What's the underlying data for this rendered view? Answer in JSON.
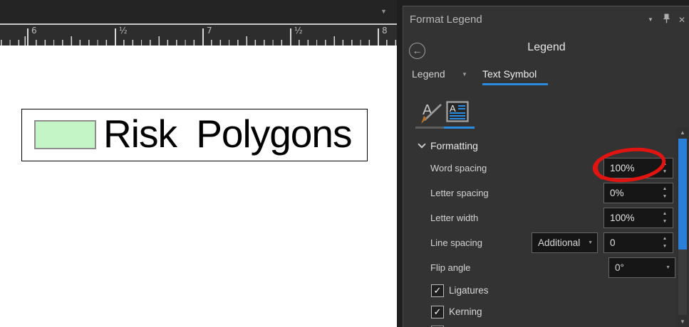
{
  "canvas": {
    "toolbar": {
      "dropdown_icon": "▼"
    },
    "ruler": {
      "labels": [
        "6",
        "½",
        "7",
        "½",
        "8"
      ]
    },
    "legend_item": {
      "label": "Risk Polygons"
    },
    "colors": {
      "swatch_fill": "#c3f5c7",
      "swatch_border": "#8d8d8d"
    }
  },
  "panel": {
    "title": "Format Legend",
    "heading": "Legend",
    "tabs": {
      "primary": "Legend",
      "secondary": "Text Symbol"
    },
    "section": "Formatting",
    "fields": {
      "word_spacing": {
        "label": "Word spacing",
        "value": "100%"
      },
      "letter_spacing": {
        "label": "Letter spacing",
        "value": "0%"
      },
      "letter_width": {
        "label": "Letter width",
        "value": "100%"
      },
      "line_spacing": {
        "label": "Line spacing",
        "mode": "Additional",
        "value": "0"
      },
      "flip_angle": {
        "label": "Flip angle",
        "value": "0°"
      }
    },
    "checkboxes": [
      {
        "label": "Ligatures",
        "check": "✓"
      },
      {
        "label": "Kerning",
        "check": "✓"
      }
    ],
    "colors": {
      "accent_blue": "#2a8ce0",
      "annotation_red": "#e01410"
    }
  },
  "icons": {
    "back": "←",
    "close": "✕",
    "header_caret": "▼",
    "tab_caret": "▼",
    "spinner_up": "▲",
    "spinner_down": "▼",
    "combo_caret": "▼",
    "scroll_up": "▲",
    "scroll_down": "▼"
  }
}
